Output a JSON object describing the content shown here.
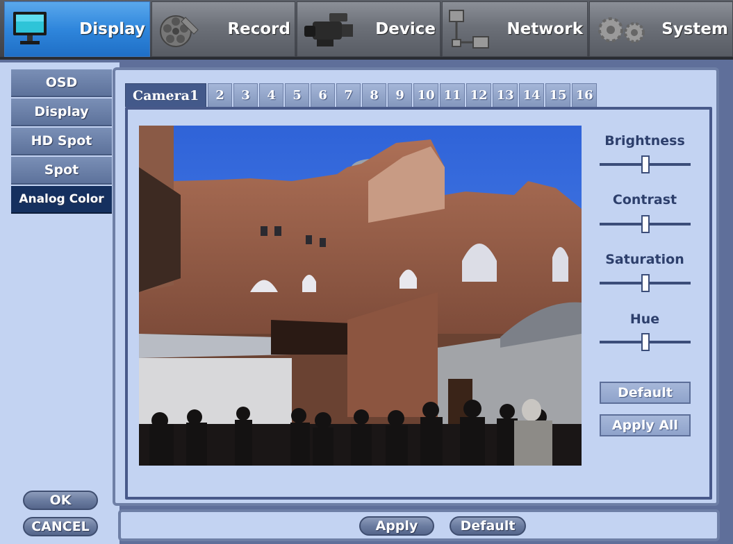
{
  "nav": {
    "tabs": [
      {
        "label": "Display",
        "icon": "monitor-icon",
        "active": true
      },
      {
        "label": "Record",
        "icon": "film-reel-icon",
        "active": false
      },
      {
        "label": "Device",
        "icon": "camcorder-icon",
        "active": false
      },
      {
        "label": "Network",
        "icon": "network-icon",
        "active": false
      },
      {
        "label": "System",
        "icon": "gears-icon",
        "active": false
      }
    ]
  },
  "sidebar": {
    "items": [
      {
        "label": "OSD",
        "active": false
      },
      {
        "label": "Display",
        "active": false
      },
      {
        "label": "HD Spot",
        "active": false
      },
      {
        "label": "Spot",
        "active": false
      },
      {
        "label": "Analog Color",
        "active": true
      }
    ],
    "ok_label": "OK",
    "cancel_label": "CANCEL"
  },
  "camera_tabs": [
    "Camera1",
    "2",
    "3",
    "4",
    "5",
    "6",
    "7",
    "8",
    "9",
    "10",
    "11",
    "12",
    "13",
    "14",
    "15",
    "16"
  ],
  "controls": {
    "brightness": {
      "label": "Brightness",
      "value": 0.5
    },
    "contrast": {
      "label": "Contrast",
      "value": 0.5
    },
    "saturation": {
      "label": "Saturation",
      "value": 0.5
    },
    "hue": {
      "label": "Hue",
      "value": 0.5
    },
    "default_label": "Default",
    "apply_all_label": "Apply All"
  },
  "footer": {
    "apply_label": "Apply",
    "default_label": "Default"
  },
  "colors": {
    "active_tab": "#2f86dc",
    "panel_bg": "#c3d3f2",
    "border": "#48598a"
  }
}
